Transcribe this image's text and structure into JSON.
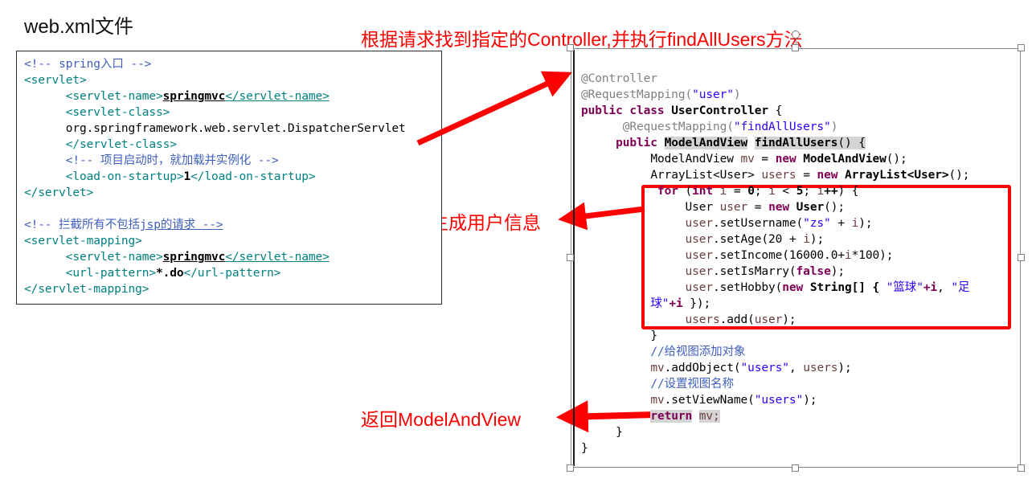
{
  "slide": {
    "title": "web.xml文件",
    "background": "#ffffff"
  },
  "colors": {
    "annotation_red": "#ff0000",
    "highlight_gray": "#d4d4d4",
    "xml_tag_teal": "#008080",
    "xml_comment_blue": "#3f5fbf",
    "java_keyword_purple": "#7f0055",
    "java_string_blue": "#2a00ff",
    "java_annotation_gray": "#808080",
    "selection_handle_gray": "#808080"
  },
  "annotations": {
    "top": "根据请求找到指定的Controller,并执行findAllUsers方法",
    "middle": "伪代码，生成用户信息",
    "bottom": "返回ModelAndView"
  },
  "xml_panel": {
    "name": "web.xml",
    "lines": [
      "<!-- spring入口 -->",
      "<servlet>",
      "      <servlet-name>springmvc</servlet-name>",
      "      <servlet-class>",
      "      org.springframework.web.servlet.DispatcherServlet",
      "      </servlet-class>",
      "      <!-- 项目启动时，就加载并实例化 -->",
      "      <load-on-startup>1</load-on-startup>",
      "</servlet>",
      "",
      "<!-- 拦截所有不包括jsp的请求 -->",
      "<servlet-mapping>",
      "      <servlet-name>springmvc</servlet-name>",
      "      <url-pattern>*.do</url-pattern>",
      "</servlet-mapping>"
    ]
  },
  "java_panel": {
    "class_name": "UserController",
    "method_name": "findAllUsers",
    "request_mapping_class": "user",
    "request_mapping_method": "findAllUsers",
    "lines": [
      "@Controller",
      "@RequestMapping(\"user\")",
      "public class UserController {",
      "      @RequestMapping(\"findAllUsers\")",
      "      public ModelAndView findAllUsers() {",
      "           ModelAndView mv = new ModelAndView();",
      "           ArrayList<User> users = new ArrayList<User>();",
      "           for (int i = 0; i < 5; i++) {",
      "                User user = new User();",
      "                user.setUsername(\"zs\" + i);",
      "                user.setAge(20 + i);",
      "                user.setIncome(16000.0+i*100);",
      "                user.setIsMarry(false);",
      "                user.setHobby(new String[] { \"篮球\"+i, \"足球\"+i });",
      "                users.add(user);",
      "           }",
      "           //给视图添加对象",
      "           mv.addObject(\"users\", users);",
      "           //设置视图名称",
      "           mv.setViewName(\"users\");",
      "           return mv;",
      "      }",
      "}"
    ],
    "loop_count": 5,
    "base_age": 20,
    "base_income": 16000.0,
    "income_step": 100,
    "username_prefix": "zs",
    "is_marry": "false",
    "hobbies": [
      "篮球",
      "足球"
    ],
    "model_attribute": "users",
    "view_name": "users",
    "highlighted_tokens": [
      "ModelAndView",
      "findAllUsers",
      "return",
      "mv;"
    ]
  },
  "selection": {
    "handle_count": 8,
    "rotation_handle": true
  }
}
